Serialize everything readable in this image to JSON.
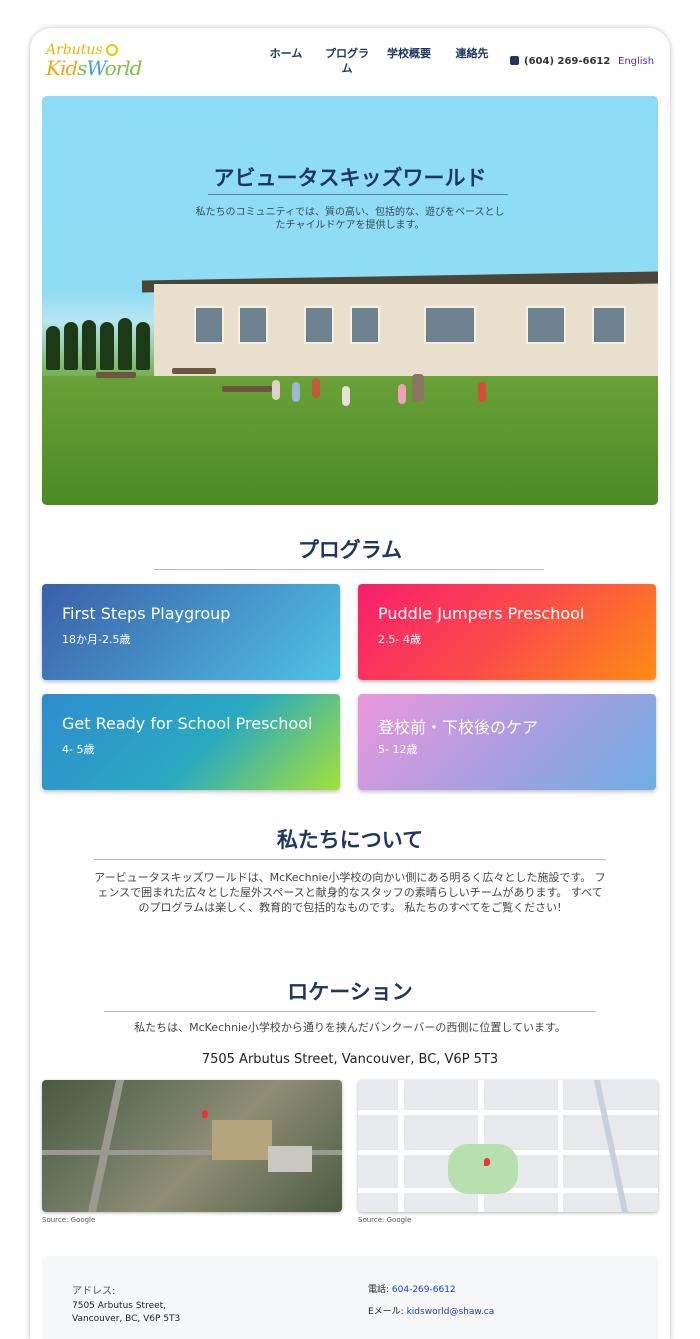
{
  "header": {
    "logo_top": "Arbutus",
    "logo_bottom_1": "Kid",
    "logo_bottom_2": "s",
    "logo_bottom_3": "W",
    "logo_bottom_4": "orld",
    "nav": {
      "home": "ホーム",
      "programs": "プログラム",
      "about": "学校概要",
      "contact": "連絡先"
    },
    "phone": "(604) 269-6612",
    "language": "English"
  },
  "hero": {
    "title": "アビュータスキッズワールド",
    "subtitle": "私たちのコミュニティでは、質の高い、包括的な、遊びをベースとしたチャイルドケアを提供します。"
  },
  "programs": {
    "title": "プログラム",
    "cards": [
      {
        "name": "First Steps Playgroup",
        "age": "18か月-2.5歳"
      },
      {
        "name": "Puddle Jumpers Preschool",
        "age": "2.5- 4歳"
      },
      {
        "name": "Get Ready for School Preschool",
        "age": "4- 5歳"
      },
      {
        "name": "登校前・下校後のケア",
        "age": "5- 12歳"
      }
    ]
  },
  "about": {
    "title": "私たちについて",
    "text": "アービュータスキッズワールドは、McKechnie小学校の向かい側にある明るく広々とした施設です。 フェンスで囲まれた広々とした屋外スペースと献身的なスタッフの素晴らしいチームがあります。 すべてのプログラムは楽しく、教育的で包括的なものです。 私たちのすべてをご覧ください!"
  },
  "location": {
    "title": "ロケーション",
    "text": "私たちは、McKechnie小学校から通りを挟んだバンクーバーの西側に位置しています。",
    "address": "7505 Arbutus Street, Vancouver, BC, V6P 5T3",
    "map_source_1": "Source: Google",
    "map_source_2": "Source: Google"
  },
  "footer": {
    "address_label": "アドレス:",
    "address_line1": "7505 Arbutus Street,",
    "address_line2": "Vancouver, BC, V6P 5T3",
    "phone_label": "電話: ",
    "phone_value": "604-269-6612",
    "email_label": "Eメール: ",
    "email_value": "kidsworld@shaw.ca"
  },
  "colors": {
    "navy": "#1f3760",
    "language_link": "#6a2aa8",
    "footer_link": "#1a3fc4"
  }
}
